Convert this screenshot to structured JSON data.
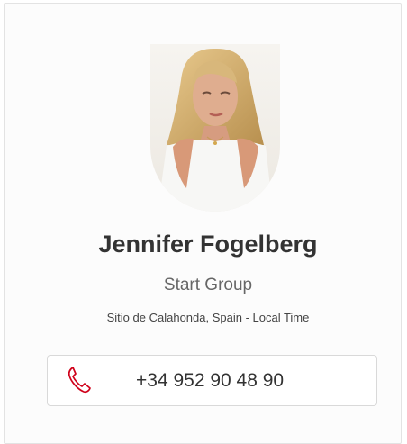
{
  "profile": {
    "name": "Jennifer Fogelberg",
    "company": "Start Group",
    "location": "Sitio de Calahonda, Spain - Local Time",
    "phone": "+34 952 90 48 90"
  },
  "icons": {
    "avatar": "profile-photo",
    "phone": "phone-handset-icon"
  },
  "colors": {
    "accent": "#d0021b",
    "text_primary": "#333333",
    "text_secondary": "#666666"
  }
}
